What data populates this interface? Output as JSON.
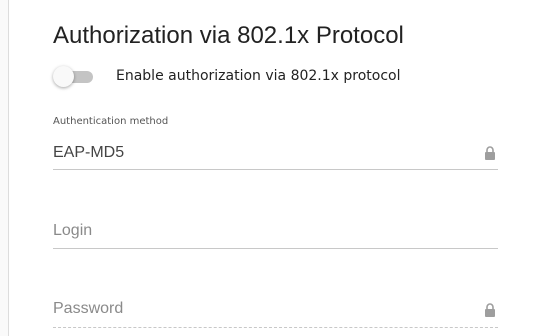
{
  "section": {
    "title": "Authorization via 802.1x Protocol"
  },
  "toggle": {
    "label": "Enable authorization via 802.1x protocol",
    "enabled": false
  },
  "auth_method": {
    "label": "Authentication method",
    "value": "EAP-MD5",
    "locked": true,
    "icon": "lock-icon"
  },
  "login": {
    "placeholder": "Login",
    "value": ""
  },
  "password": {
    "placeholder": "Password",
    "value": "",
    "locked": true,
    "icon": "lock-icon"
  },
  "colors": {
    "text": "#222222",
    "muted": "#8a8a8a",
    "line": "#c8c8c8",
    "toggle_track": "#c4c4c4",
    "lock": "#9e9e9e"
  }
}
